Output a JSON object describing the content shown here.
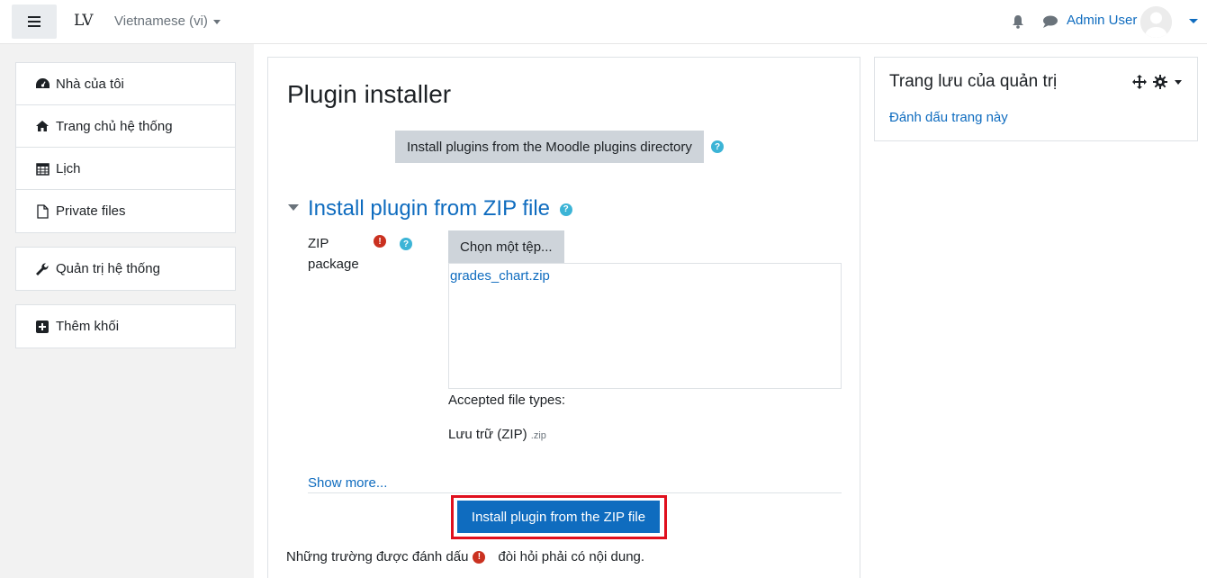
{
  "navbar": {
    "menu_icon": "hamburger-icon",
    "brand": "LV",
    "language": "Vietnamese (vi)",
    "user_name": "Admin User"
  },
  "drawer": {
    "group1": [
      {
        "label": "Nhà của tôi",
        "icon": "dashboard-icon"
      },
      {
        "label": "Trang chủ hệ thống",
        "icon": "home-icon"
      },
      {
        "label": "Lịch",
        "icon": "calendar-icon"
      },
      {
        "label": "Private files",
        "icon": "file-icon"
      }
    ],
    "group2": [
      {
        "label": "Quản trị hệ thống",
        "icon": "wrench-icon"
      }
    ],
    "group3": [
      {
        "label": "Thêm khối",
        "icon": "plus-square-icon"
      }
    ]
  },
  "main": {
    "title": "Plugin installer",
    "directory_button": "Install plugins from the Moodle plugins directory",
    "section_title": "Install plugin from ZIP file",
    "zip_label_line1": "ZIP",
    "zip_label_line2": "package",
    "choose_button": "Chọn một tệp...",
    "selected_file": "grades_chart.zip",
    "accepted_label": "Accepted file types:",
    "file_type_name": "Lưu trữ (ZIP)",
    "file_type_ext": ".zip",
    "show_more": "Show more...",
    "install_button": "Install plugin from the ZIP file",
    "required_note_before": "Những trường được đánh dấu",
    "required_note_after": "đòi hỏi phải có nội dung."
  },
  "block": {
    "title": "Trang lưu của quản trị",
    "bookmark_link": "Đánh dấu trang này"
  },
  "colors": {
    "link": "#0f6cbf",
    "primary_button": "#0f6cbf",
    "secondary_button": "#ced4da",
    "required": "#ca3120",
    "help": "#3cb4d6",
    "highlight_outline": "#e0101e"
  }
}
